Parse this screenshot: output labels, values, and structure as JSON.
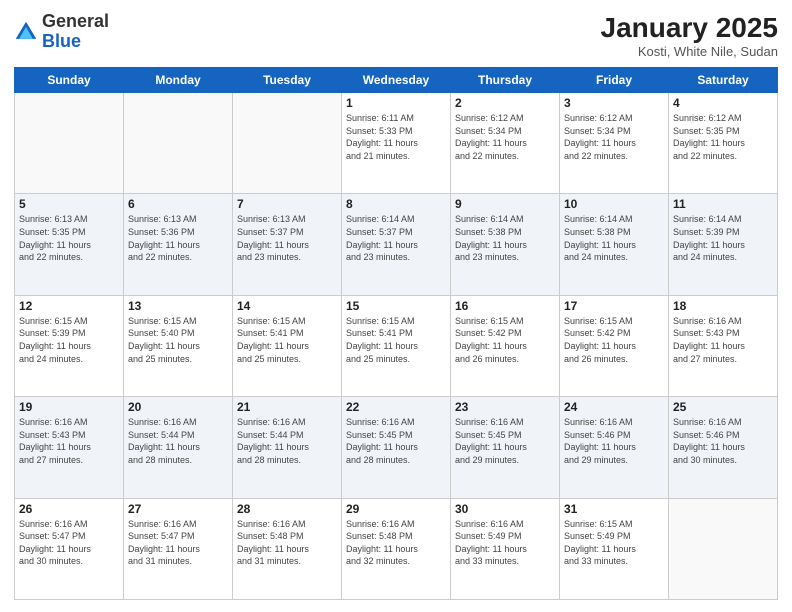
{
  "header": {
    "logo_general": "General",
    "logo_blue": "Blue",
    "title": "January 2025",
    "subtitle": "Kosti, White Nile, Sudan"
  },
  "weekdays": [
    "Sunday",
    "Monday",
    "Tuesday",
    "Wednesday",
    "Thursday",
    "Friday",
    "Saturday"
  ],
  "weeks": [
    {
      "shaded": false,
      "days": [
        {
          "num": "",
          "info": "",
          "empty": true
        },
        {
          "num": "",
          "info": "",
          "empty": true
        },
        {
          "num": "",
          "info": "",
          "empty": true
        },
        {
          "num": "1",
          "info": "Sunrise: 6:11 AM\nSunset: 5:33 PM\nDaylight: 11 hours\nand 21 minutes.",
          "empty": false
        },
        {
          "num": "2",
          "info": "Sunrise: 6:12 AM\nSunset: 5:34 PM\nDaylight: 11 hours\nand 22 minutes.",
          "empty": false
        },
        {
          "num": "3",
          "info": "Sunrise: 6:12 AM\nSunset: 5:34 PM\nDaylight: 11 hours\nand 22 minutes.",
          "empty": false
        },
        {
          "num": "4",
          "info": "Sunrise: 6:12 AM\nSunset: 5:35 PM\nDaylight: 11 hours\nand 22 minutes.",
          "empty": false
        }
      ]
    },
    {
      "shaded": true,
      "days": [
        {
          "num": "5",
          "info": "Sunrise: 6:13 AM\nSunset: 5:35 PM\nDaylight: 11 hours\nand 22 minutes.",
          "empty": false
        },
        {
          "num": "6",
          "info": "Sunrise: 6:13 AM\nSunset: 5:36 PM\nDaylight: 11 hours\nand 22 minutes.",
          "empty": false
        },
        {
          "num": "7",
          "info": "Sunrise: 6:13 AM\nSunset: 5:37 PM\nDaylight: 11 hours\nand 23 minutes.",
          "empty": false
        },
        {
          "num": "8",
          "info": "Sunrise: 6:14 AM\nSunset: 5:37 PM\nDaylight: 11 hours\nand 23 minutes.",
          "empty": false
        },
        {
          "num": "9",
          "info": "Sunrise: 6:14 AM\nSunset: 5:38 PM\nDaylight: 11 hours\nand 23 minutes.",
          "empty": false
        },
        {
          "num": "10",
          "info": "Sunrise: 6:14 AM\nSunset: 5:38 PM\nDaylight: 11 hours\nand 24 minutes.",
          "empty": false
        },
        {
          "num": "11",
          "info": "Sunrise: 6:14 AM\nSunset: 5:39 PM\nDaylight: 11 hours\nand 24 minutes.",
          "empty": false
        }
      ]
    },
    {
      "shaded": false,
      "days": [
        {
          "num": "12",
          "info": "Sunrise: 6:15 AM\nSunset: 5:39 PM\nDaylight: 11 hours\nand 24 minutes.",
          "empty": false
        },
        {
          "num": "13",
          "info": "Sunrise: 6:15 AM\nSunset: 5:40 PM\nDaylight: 11 hours\nand 25 minutes.",
          "empty": false
        },
        {
          "num": "14",
          "info": "Sunrise: 6:15 AM\nSunset: 5:41 PM\nDaylight: 11 hours\nand 25 minutes.",
          "empty": false
        },
        {
          "num": "15",
          "info": "Sunrise: 6:15 AM\nSunset: 5:41 PM\nDaylight: 11 hours\nand 25 minutes.",
          "empty": false
        },
        {
          "num": "16",
          "info": "Sunrise: 6:15 AM\nSunset: 5:42 PM\nDaylight: 11 hours\nand 26 minutes.",
          "empty": false
        },
        {
          "num": "17",
          "info": "Sunrise: 6:15 AM\nSunset: 5:42 PM\nDaylight: 11 hours\nand 26 minutes.",
          "empty": false
        },
        {
          "num": "18",
          "info": "Sunrise: 6:16 AM\nSunset: 5:43 PM\nDaylight: 11 hours\nand 27 minutes.",
          "empty": false
        }
      ]
    },
    {
      "shaded": true,
      "days": [
        {
          "num": "19",
          "info": "Sunrise: 6:16 AM\nSunset: 5:43 PM\nDaylight: 11 hours\nand 27 minutes.",
          "empty": false
        },
        {
          "num": "20",
          "info": "Sunrise: 6:16 AM\nSunset: 5:44 PM\nDaylight: 11 hours\nand 28 minutes.",
          "empty": false
        },
        {
          "num": "21",
          "info": "Sunrise: 6:16 AM\nSunset: 5:44 PM\nDaylight: 11 hours\nand 28 minutes.",
          "empty": false
        },
        {
          "num": "22",
          "info": "Sunrise: 6:16 AM\nSunset: 5:45 PM\nDaylight: 11 hours\nand 28 minutes.",
          "empty": false
        },
        {
          "num": "23",
          "info": "Sunrise: 6:16 AM\nSunset: 5:45 PM\nDaylight: 11 hours\nand 29 minutes.",
          "empty": false
        },
        {
          "num": "24",
          "info": "Sunrise: 6:16 AM\nSunset: 5:46 PM\nDaylight: 11 hours\nand 29 minutes.",
          "empty": false
        },
        {
          "num": "25",
          "info": "Sunrise: 6:16 AM\nSunset: 5:46 PM\nDaylight: 11 hours\nand 30 minutes.",
          "empty": false
        }
      ]
    },
    {
      "shaded": false,
      "days": [
        {
          "num": "26",
          "info": "Sunrise: 6:16 AM\nSunset: 5:47 PM\nDaylight: 11 hours\nand 30 minutes.",
          "empty": false
        },
        {
          "num": "27",
          "info": "Sunrise: 6:16 AM\nSunset: 5:47 PM\nDaylight: 11 hours\nand 31 minutes.",
          "empty": false
        },
        {
          "num": "28",
          "info": "Sunrise: 6:16 AM\nSunset: 5:48 PM\nDaylight: 11 hours\nand 31 minutes.",
          "empty": false
        },
        {
          "num": "29",
          "info": "Sunrise: 6:16 AM\nSunset: 5:48 PM\nDaylight: 11 hours\nand 32 minutes.",
          "empty": false
        },
        {
          "num": "30",
          "info": "Sunrise: 6:16 AM\nSunset: 5:49 PM\nDaylight: 11 hours\nand 33 minutes.",
          "empty": false
        },
        {
          "num": "31",
          "info": "Sunrise: 6:15 AM\nSunset: 5:49 PM\nDaylight: 11 hours\nand 33 minutes.",
          "empty": false
        },
        {
          "num": "",
          "info": "",
          "empty": true
        }
      ]
    }
  ]
}
